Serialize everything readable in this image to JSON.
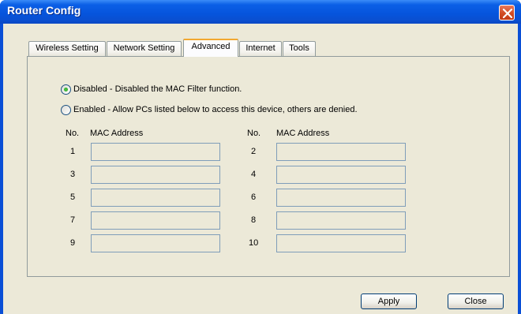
{
  "window": {
    "title": "Router Config"
  },
  "tabs": [
    {
      "label": "Wireless Setting"
    },
    {
      "label": "Network Setting"
    },
    {
      "label": "Advanced"
    },
    {
      "label": "Internet"
    },
    {
      "label": "Tools"
    }
  ],
  "active_tab": "Advanced",
  "mac_filter": {
    "selected": "disabled",
    "option_disabled": "Disabled - Disabled the MAC Filter function.",
    "option_enabled": "Enabled - Allow PCs listed below to access this device, others are denied.",
    "col_no_label": "No.",
    "col_mac_label": "MAC Address",
    "rows": [
      {
        "left_no": "1",
        "left_mac": "",
        "right_no": "2",
        "right_mac": ""
      },
      {
        "left_no": "3",
        "left_mac": "",
        "right_no": "4",
        "right_mac": ""
      },
      {
        "left_no": "5",
        "left_mac": "",
        "right_no": "6",
        "right_mac": ""
      },
      {
        "left_no": "7",
        "left_mac": "",
        "right_no": "8",
        "right_mac": ""
      },
      {
        "left_no": "9",
        "left_mac": "",
        "right_no": "10",
        "right_mac": ""
      }
    ]
  },
  "buttons": {
    "apply": "Apply",
    "close": "Close"
  },
  "icons": {
    "close": "close-icon"
  }
}
